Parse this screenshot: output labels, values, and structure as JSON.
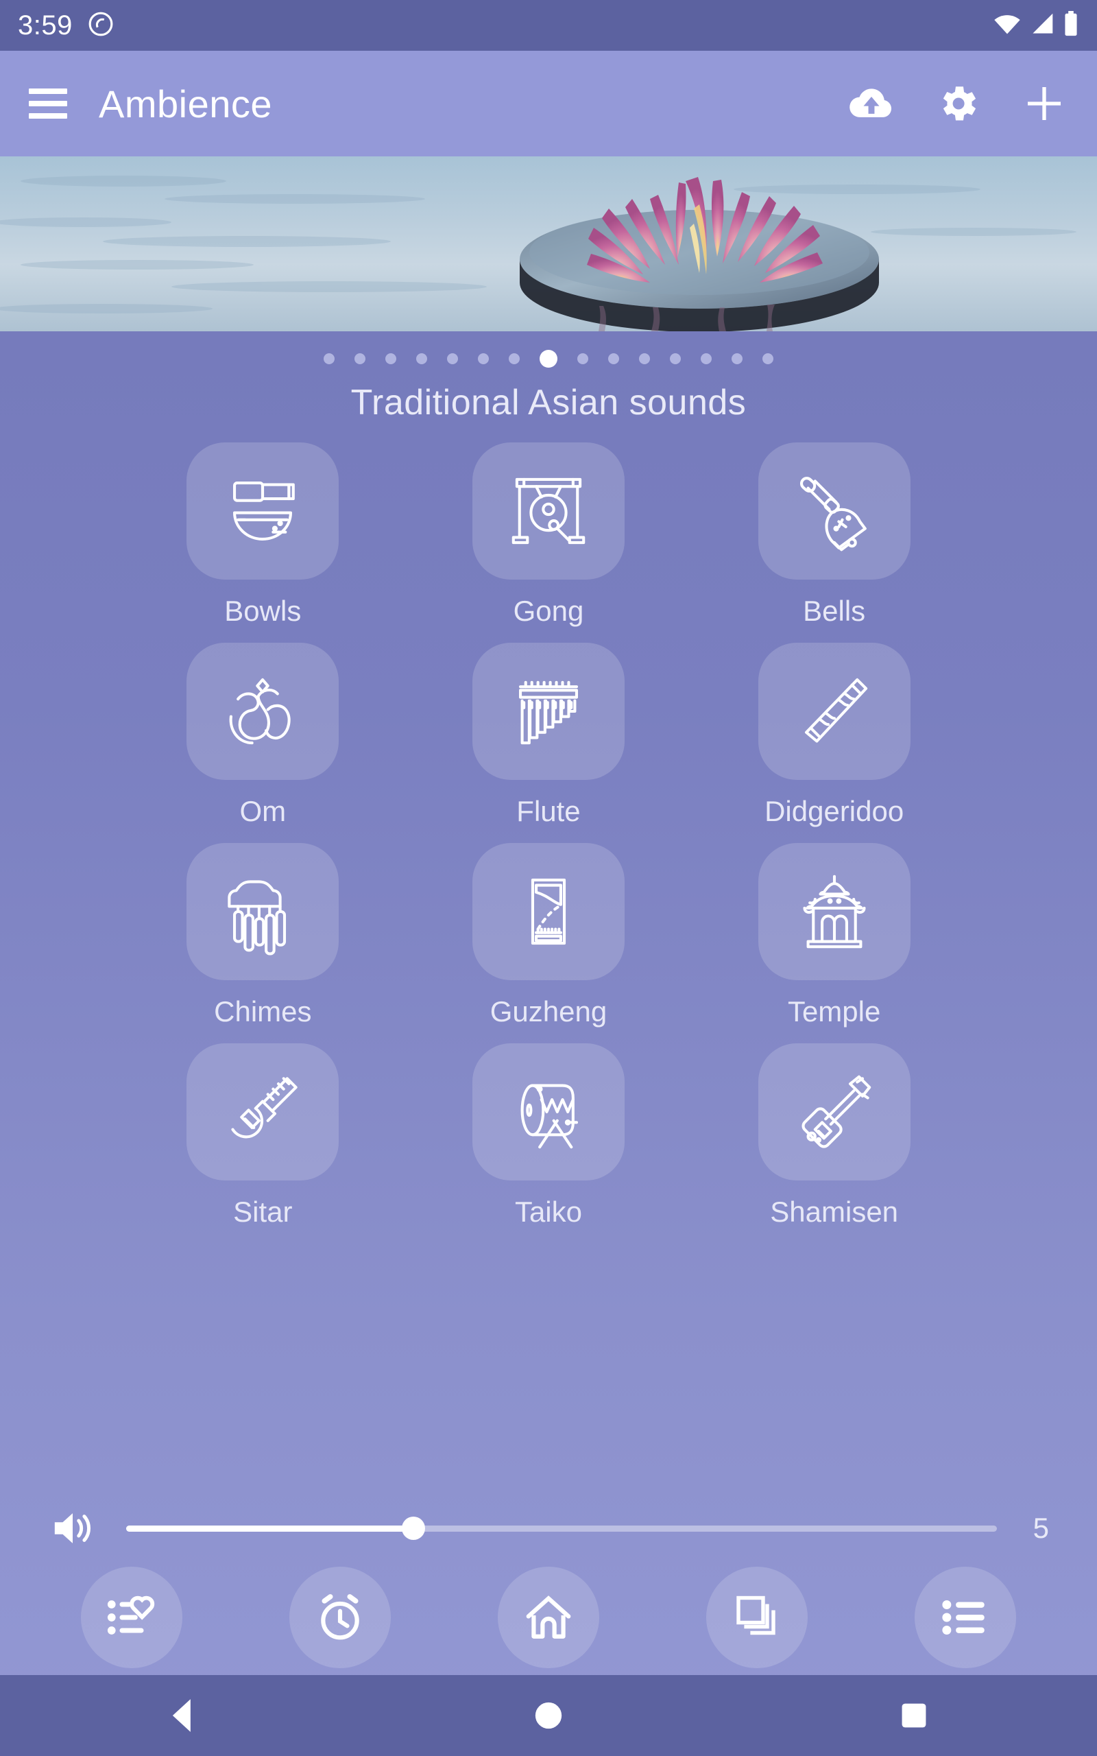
{
  "status_bar": {
    "time": "3:59",
    "icons": [
      "screen-record-icon",
      "wifi-icon",
      "cell-signal-icon",
      "battery-icon"
    ]
  },
  "app_bar": {
    "menu_icon": "hamburger-menu-icon",
    "title": "Ambience",
    "actions": [
      {
        "name": "cloud-upload-icon",
        "label": "Cloud upload"
      },
      {
        "name": "settings-gear-icon",
        "label": "Settings"
      },
      {
        "name": "plus-add-icon",
        "label": "Add"
      }
    ]
  },
  "hero": {
    "alt": "Pink water lily floating on calm water",
    "pager": {
      "total": 15,
      "active_index": 7
    }
  },
  "section": {
    "title": "Traditional Asian sounds"
  },
  "sounds": [
    {
      "label": "Bowls",
      "icon": "singing-bowl-icon"
    },
    {
      "label": "Gong",
      "icon": "gong-icon"
    },
    {
      "label": "Bells",
      "icon": "handbell-icon"
    },
    {
      "label": "Om",
      "icon": "om-symbol-icon"
    },
    {
      "label": "Flute",
      "icon": "pan-flute-icon"
    },
    {
      "label": "Didgeridoo",
      "icon": "didgeridoo-icon"
    },
    {
      "label": "Chimes",
      "icon": "wind-chimes-icon"
    },
    {
      "label": "Guzheng",
      "icon": "guzheng-icon"
    },
    {
      "label": "Temple",
      "icon": "pagoda-temple-icon"
    },
    {
      "label": "Sitar",
      "icon": "sitar-icon"
    },
    {
      "label": "Taiko",
      "icon": "taiko-drum-icon"
    },
    {
      "label": "Shamisen",
      "icon": "shamisen-icon"
    }
  ],
  "volume": {
    "icon": "speaker-volume-icon",
    "value": "5",
    "percent": 33,
    "min": "0",
    "max": "15"
  },
  "bottom_toolbar": [
    {
      "name": "favorites-icon",
      "label": "Favorites"
    },
    {
      "name": "timer-alarm-icon",
      "label": "Timer"
    },
    {
      "name": "home-icon",
      "label": "Home"
    },
    {
      "name": "mixes-icon",
      "label": "Mixes"
    },
    {
      "name": "list-icon",
      "label": "List"
    }
  ],
  "android_nav": [
    {
      "name": "nav-back-icon",
      "label": "Back"
    },
    {
      "name": "nav-home-icon",
      "label": "Home"
    },
    {
      "name": "nav-recents-icon",
      "label": "Recents"
    }
  ],
  "colors": {
    "status_bar": "#5c62a0",
    "app_bar": "#9499d8",
    "background_top": "#7277b8",
    "background_bottom": "#9398d4",
    "tile": "rgba(255,255,255,0.17)",
    "accent_text": "#e9eaf8"
  }
}
